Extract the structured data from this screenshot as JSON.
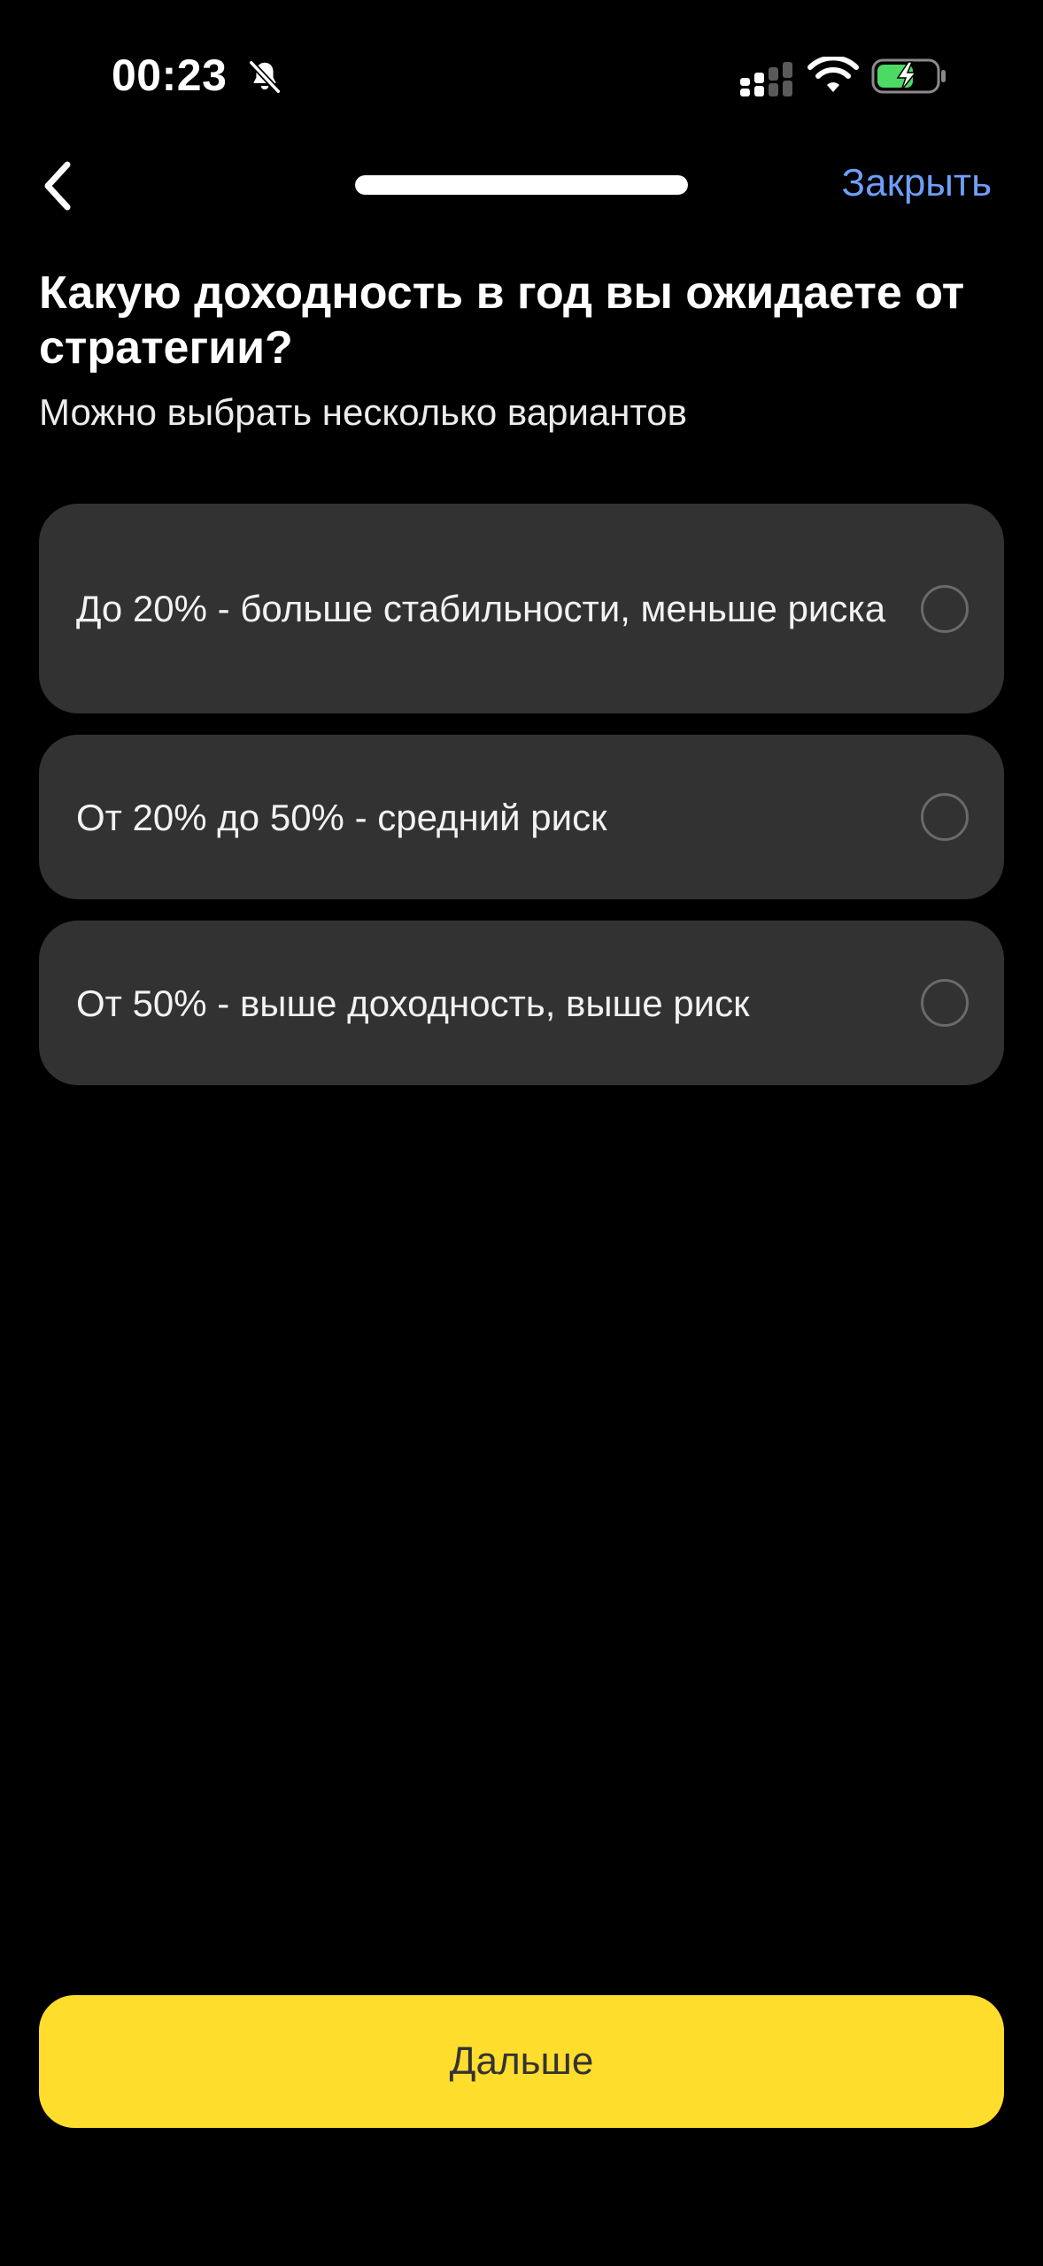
{
  "status_bar": {
    "time": "00:23"
  },
  "nav": {
    "close_label": "Закрыть",
    "progress_fraction": 1.0
  },
  "question": {
    "title": "Какую доходность в год вы ожидаете от стратегии?",
    "subtitle": "Можно выбрать несколько вариантов"
  },
  "options": [
    {
      "label": "До 20% - больше стабильности, меньше риска",
      "selected": false
    },
    {
      "label": "От 20% до 50% - средний риск",
      "selected": false
    },
    {
      "label": "От 50% - выше доходность, выше риск",
      "selected": false
    }
  ],
  "next_button": {
    "label": "Дальше"
  },
  "colors": {
    "background": "#000000",
    "card": "#323232",
    "accent_link": "#6f9ef8",
    "primary_button": "#ffdd2d",
    "battery_charge": "#4cd964"
  },
  "icons": [
    "back-chevron-icon",
    "bell-off-icon",
    "signal-icon",
    "wifi-icon",
    "battery-charging-icon"
  ]
}
